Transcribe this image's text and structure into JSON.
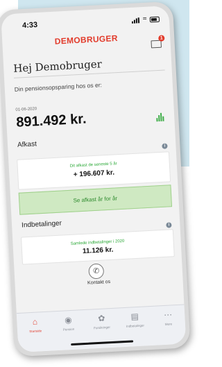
{
  "status": {
    "time": "4:33"
  },
  "header": {
    "title": "DEMOBRUGER",
    "mail_badge": "1"
  },
  "greeting": "Hej Demobruger",
  "pension": {
    "subtitle": "Din pensionsopsparing hos os er:",
    "date": "01-06-2020",
    "amount": "891.492 kr."
  },
  "afkast": {
    "title": "Afkast",
    "caption": "Dit afkast de seneste 5 år",
    "value": "+ 196.607 kr.",
    "button_label": "Se afkast år for år"
  },
  "indbetalinger": {
    "title": "Indbetalinger",
    "caption": "Samlede indbetalinger i 2020",
    "value": "11.126 kr."
  },
  "contact": {
    "label": "Kontakt os"
  },
  "tabs": [
    {
      "label": "Startside",
      "icon": "home-icon"
    },
    {
      "label": "Pension",
      "icon": "piggy-bank-icon"
    },
    {
      "label": "Forsikringer",
      "icon": "insurance-icon"
    },
    {
      "label": "Indbetalinger",
      "icon": "payments-icon"
    },
    {
      "label": "Mere",
      "icon": "more-icon"
    }
  ],
  "colors": {
    "brand": "#e23b2b",
    "positive": "#2aa836",
    "cta_bg": "#cfe9c2",
    "backdrop": "#cfe6ef"
  }
}
